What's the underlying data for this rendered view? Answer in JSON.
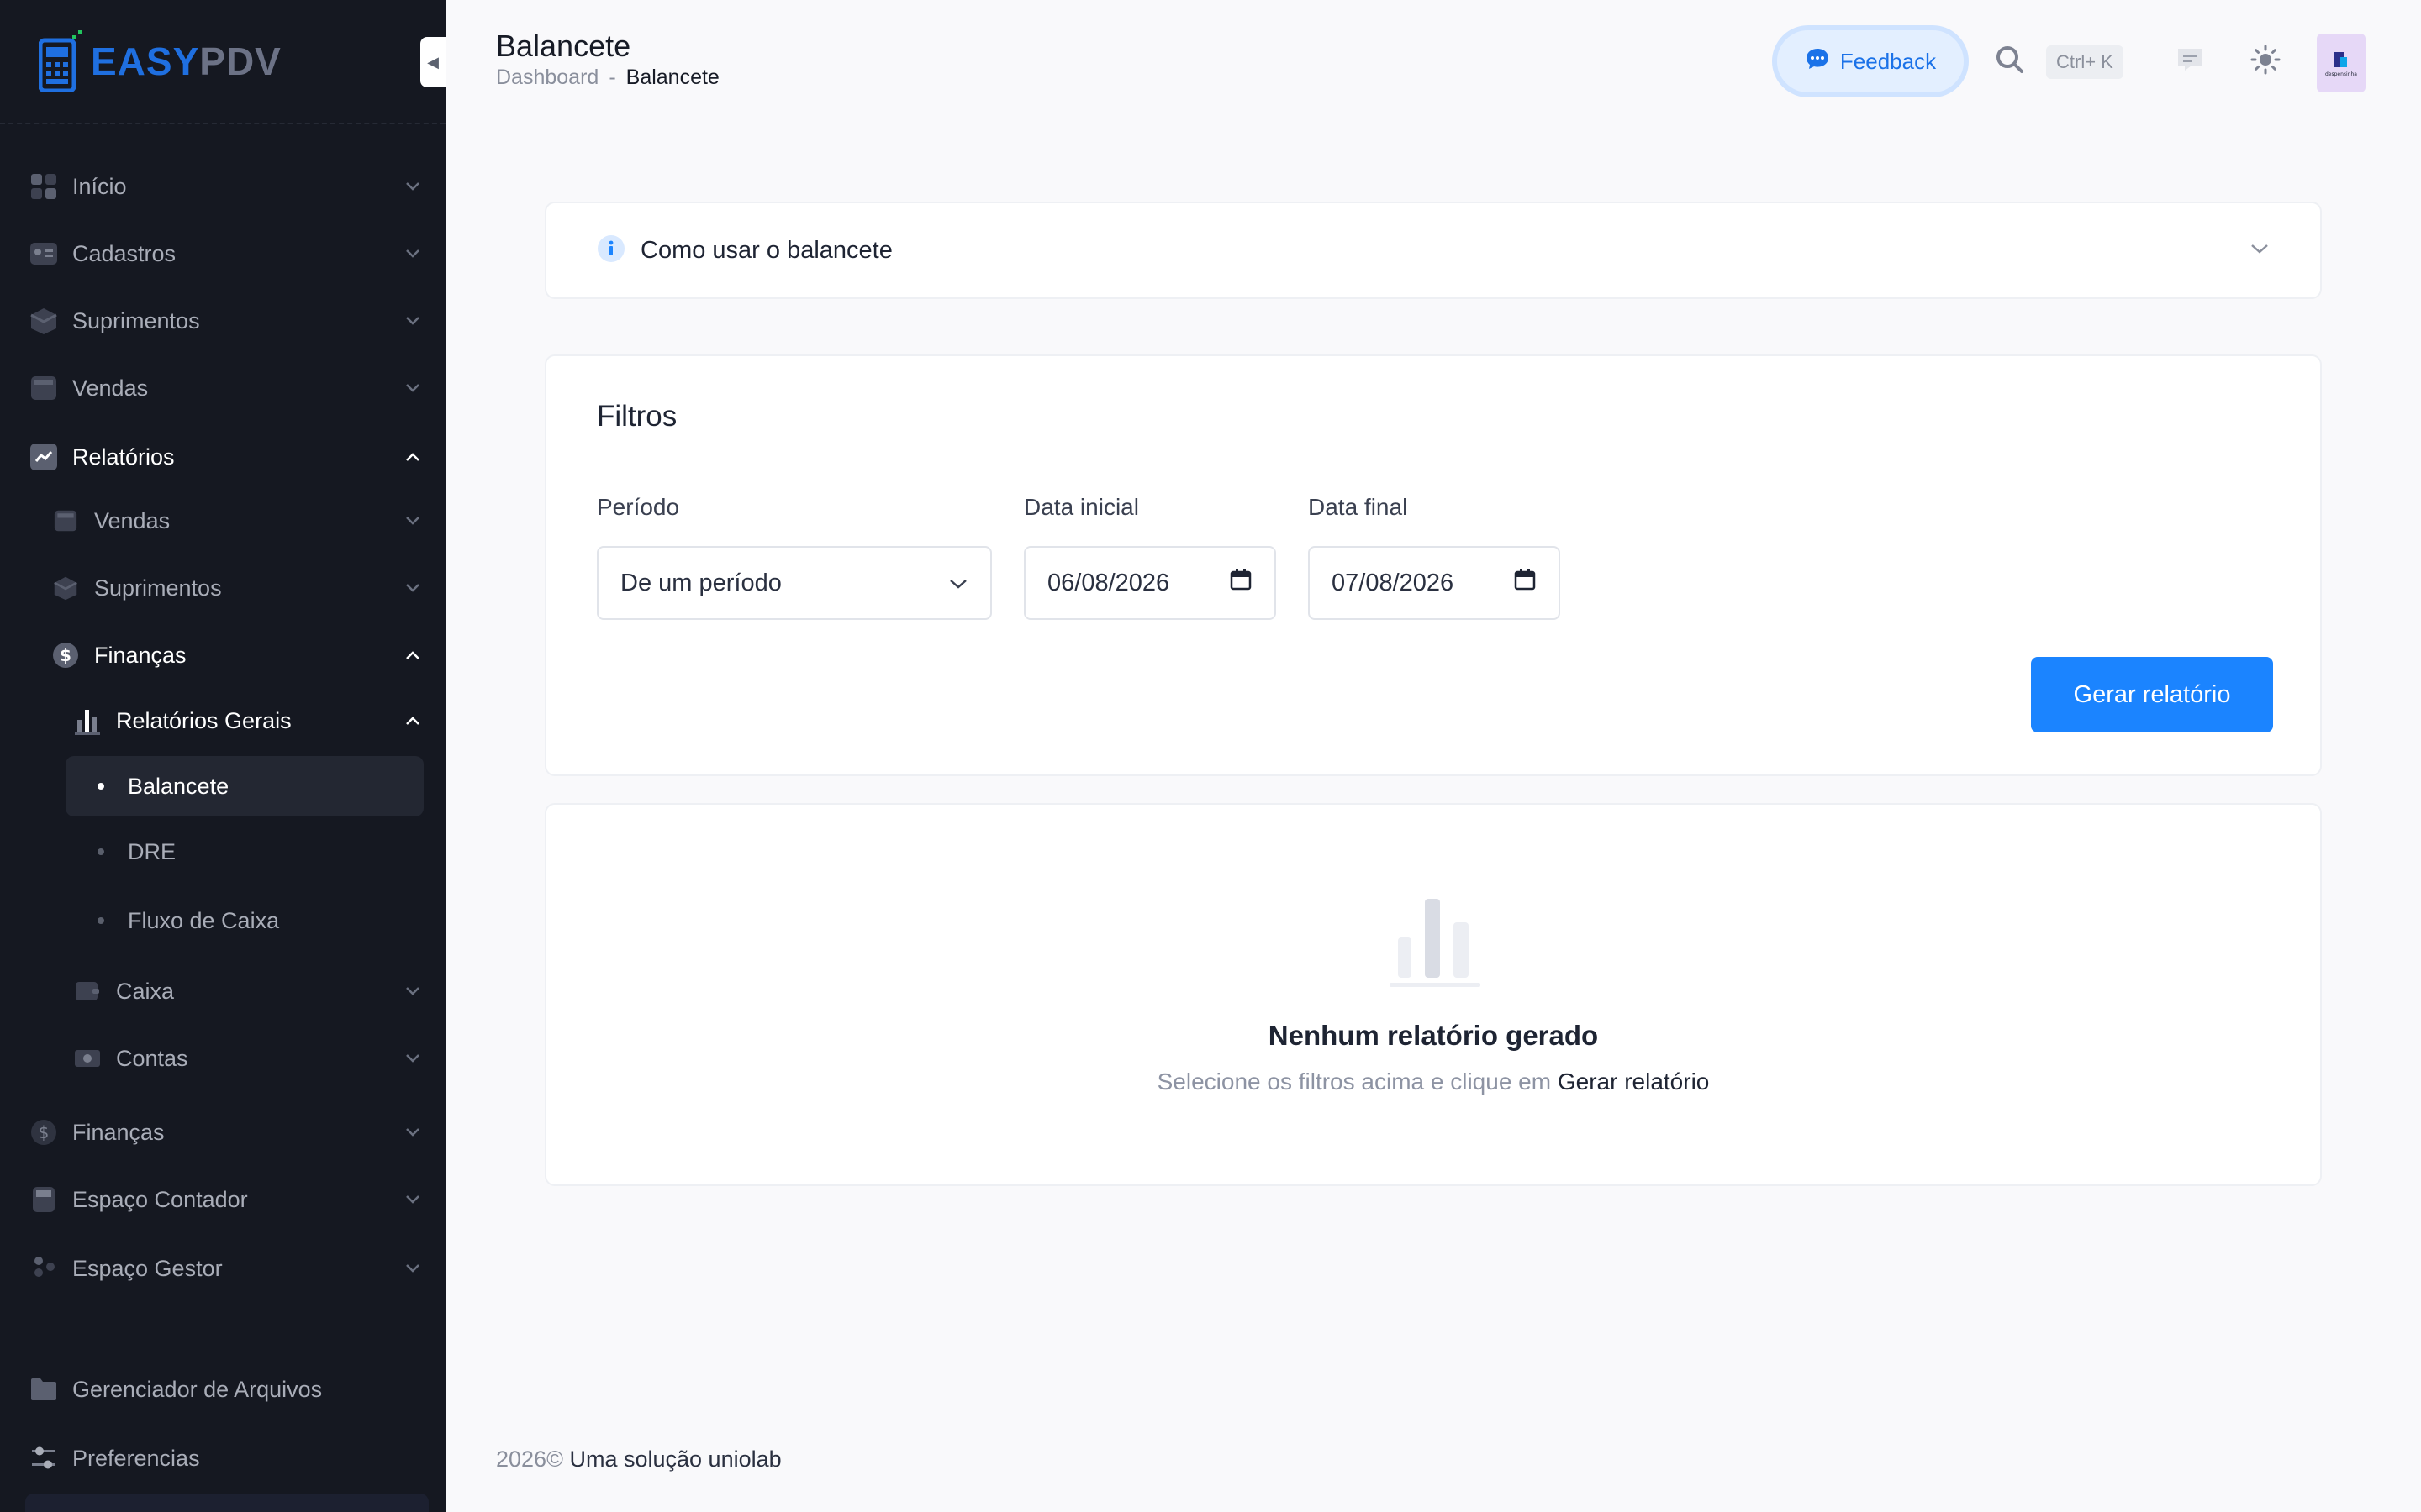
{
  "app": {
    "logo_easy": "EASY",
    "logo_pdv": "PDV"
  },
  "sidebar": {
    "items": [
      {
        "label": "Início",
        "icon": "home-grid-icon"
      },
      {
        "label": "Cadastros",
        "icon": "id-card-icon"
      },
      {
        "label": "Suprimentos",
        "icon": "box-icon"
      },
      {
        "label": "Vendas",
        "icon": "register-icon"
      },
      {
        "label": "Relatórios",
        "icon": "chart-line-icon"
      },
      {
        "label": "Vendas",
        "icon": "register-icon"
      },
      {
        "label": "Suprimentos",
        "icon": "box-icon"
      },
      {
        "label": "Finanças",
        "icon": "dollar-icon"
      },
      {
        "label": "Relatórios Gerais",
        "icon": "bar-chart-icon"
      },
      {
        "label": "Balancete"
      },
      {
        "label": "DRE"
      },
      {
        "label": "Fluxo de Caixa"
      },
      {
        "label": "Caixa",
        "icon": "cash-drawer-icon"
      },
      {
        "label": "Contas",
        "icon": "banknote-icon"
      },
      {
        "label": "Finanças",
        "icon": "dollar-icon"
      },
      {
        "label": "Espaço Contador",
        "icon": "calculator-icon"
      },
      {
        "label": "Espaço Gestor",
        "icon": "people-icon"
      },
      {
        "label": "Gerenciador de Arquivos",
        "icon": "folder-icon"
      },
      {
        "label": "Preferencias",
        "icon": "sliders-icon"
      }
    ]
  },
  "header": {
    "title": "Balancete",
    "breadcrumb": [
      "Dashboard",
      "Balancete"
    ],
    "feedback_label": "Feedback",
    "shortcut": "Ctrl+ K",
    "avatar_text": "despensinha"
  },
  "howto": {
    "label": "Como usar o balancete"
  },
  "filters": {
    "title": "Filtros",
    "periodo_label": "Período",
    "periodo_value": "De um período",
    "data_inicial_label": "Data inicial",
    "data_inicial_value": "06/08/2026",
    "data_final_label": "Data final",
    "data_final_value": "07/08/2026",
    "generate_label": "Gerar relatório"
  },
  "empty": {
    "title": "Nenhum relatório gerado",
    "subtitle_prefix": "Selecione os filtros acima e clique em",
    "subtitle_action": "Gerar relatório"
  },
  "footer": {
    "year": "2026©",
    "text": "Uma solução uniolab"
  },
  "colors": {
    "primary": "#1b84ff",
    "sidebar_bg": "#151821",
    "page_bg": "#f9f9fb"
  }
}
